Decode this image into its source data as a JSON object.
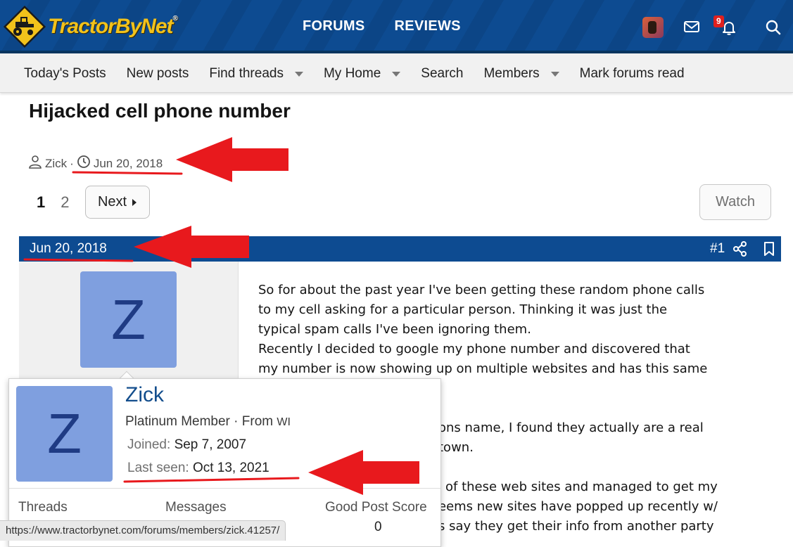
{
  "header": {
    "logo_text": "TractorByNet",
    "logo_mark": "®",
    "nav": [
      "FORUMS",
      "REVIEWS"
    ],
    "alerts_count": "9",
    "colors": {
      "header_bg": "#0d4b91",
      "logo_yellow": "#f2c21b",
      "annotation_red": "#e8191d"
    }
  },
  "subnav": {
    "items": [
      {
        "label": "Today's Posts",
        "dropdown": false
      },
      {
        "label": "New posts",
        "dropdown": false
      },
      {
        "label": "Find threads",
        "dropdown": true
      },
      {
        "label": "My Home",
        "dropdown": true
      },
      {
        "label": "Search",
        "dropdown": false
      },
      {
        "label": "Members",
        "dropdown": true
      },
      {
        "label": "Mark forums read",
        "dropdown": false
      }
    ]
  },
  "thread": {
    "title": "Hijacked cell phone number",
    "author": "Zick",
    "separator": "·",
    "date": "Jun 20, 2018"
  },
  "pager": {
    "pages": [
      "1",
      "2"
    ],
    "current": "1",
    "next_label": "Next",
    "watch_label": "Watch"
  },
  "post": {
    "date": "Jun 20, 2018",
    "number": "#1",
    "avatar_letter": "Z",
    "body_lines": [
      "So for about the past year I've been getting these random phone calls",
      "to my cell asking for a particular person. Thinking it was just the",
      "typical spam calls I've been ignoring them.",
      "Recently I decided to google my phone number and discovered that",
      "my number is now showing up on multiple websites and has this same",
      "",
      "",
      "ons name, I found they actually are a real",
      "town.",
      "",
      "of these web sites and managed to get my",
      "eems new sites have popped up recently w/",
      "s say they get their info from another party"
    ]
  },
  "member_card": {
    "avatar_letter": "Z",
    "name": "Zick",
    "title": "Platinum Member",
    "from_label": "From",
    "from_value": "WI",
    "joined_label": "Joined:",
    "joined_value": "Sep 7, 2007",
    "last_seen_label": "Last seen:",
    "last_seen_value": "Oct 13, 2021",
    "stats": [
      {
        "label": "Threads",
        "value": ""
      },
      {
        "label": "Messages",
        "value": ""
      },
      {
        "label": "Good Post Score",
        "value": "0"
      }
    ]
  },
  "status_url": "https://www.tractorbynet.com/forums/members/zick.41257/"
}
